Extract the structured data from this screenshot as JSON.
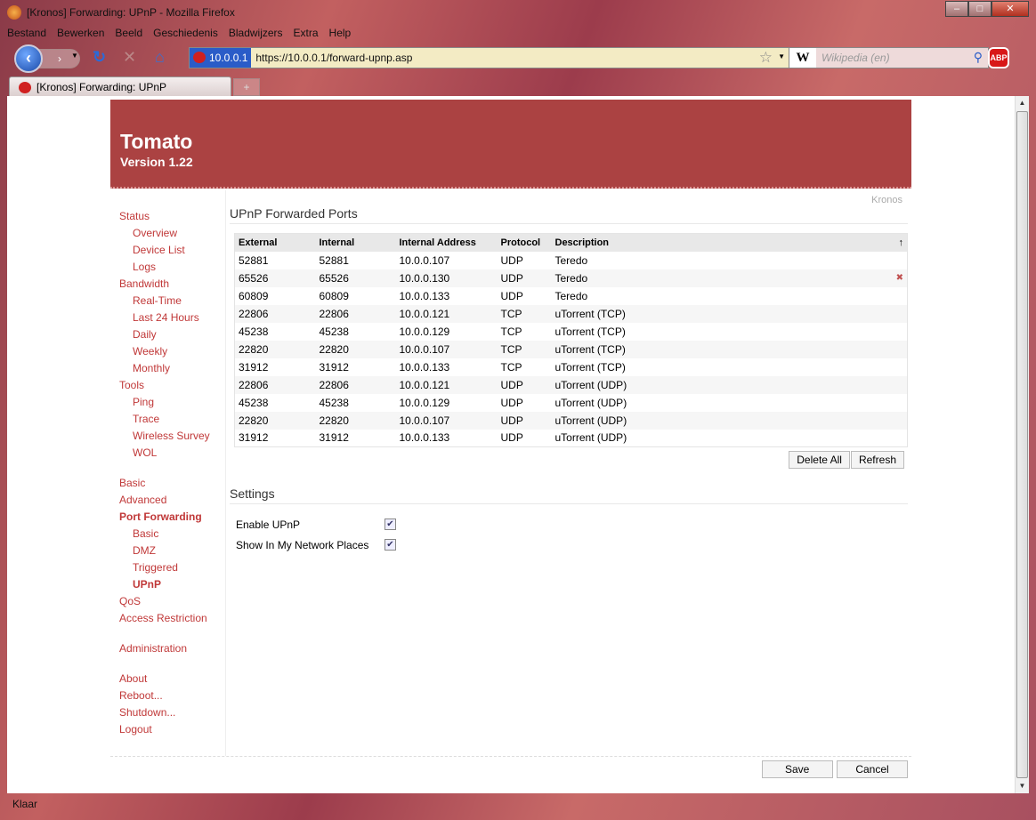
{
  "window": {
    "title": "[Kronos] Forwarding: UPnP - Mozilla Firefox"
  },
  "menu": [
    "Bestand",
    "Bewerken",
    "Beeld",
    "Geschiedenis",
    "Bladwijzers",
    "Extra",
    "Help"
  ],
  "urlbar": {
    "identity": "10.0.0.1",
    "url": "https://10.0.0.1/forward-upnp.asp"
  },
  "search": {
    "engine": "W",
    "placeholder": "Wikipedia (en)"
  },
  "abp": "ABP",
  "tab": {
    "label": "[Kronos] Forwarding: UPnP",
    "new": "+"
  },
  "status": "Klaar",
  "header": {
    "title": "Tomato",
    "version": "Version 1.22"
  },
  "router_name": "Kronos",
  "sidebar": [
    {
      "label": "Status",
      "sub": false
    },
    {
      "label": "Overview",
      "sub": true
    },
    {
      "label": "Device List",
      "sub": true
    },
    {
      "label": "Logs",
      "sub": true
    },
    {
      "label": "Bandwidth",
      "sub": false
    },
    {
      "label": "Real-Time",
      "sub": true
    },
    {
      "label": "Last 24 Hours",
      "sub": true
    },
    {
      "label": "Daily",
      "sub": true
    },
    {
      "label": "Weekly",
      "sub": true
    },
    {
      "label": "Monthly",
      "sub": true
    },
    {
      "label": "Tools",
      "sub": false
    },
    {
      "label": "Ping",
      "sub": true
    },
    {
      "label": "Trace",
      "sub": true
    },
    {
      "label": "Wireless Survey",
      "sub": true
    },
    {
      "label": "WOL",
      "sub": true
    },
    {
      "gap": true
    },
    {
      "label": "Basic",
      "sub": false
    },
    {
      "label": "Advanced",
      "sub": false
    },
    {
      "label": "Port Forwarding",
      "sub": false,
      "active": true
    },
    {
      "label": "Basic",
      "sub": true
    },
    {
      "label": "DMZ",
      "sub": true
    },
    {
      "label": "Triggered",
      "sub": true
    },
    {
      "label": "UPnP",
      "sub": true,
      "active": true
    },
    {
      "label": "QoS",
      "sub": false
    },
    {
      "label": "Access Restriction",
      "sub": false
    },
    {
      "gap": true
    },
    {
      "label": "Administration",
      "sub": false
    },
    {
      "gap": true
    },
    {
      "label": "About",
      "sub": false
    },
    {
      "label": "Reboot...",
      "sub": false
    },
    {
      "label": "Shutdown...",
      "sub": false
    },
    {
      "label": "Logout",
      "sub": false
    }
  ],
  "ports": {
    "title": "UPnP Forwarded Ports",
    "columns": [
      "External",
      "Internal",
      "Internal Address",
      "Protocol",
      "Description"
    ],
    "sort_icon": "↑",
    "rows": [
      [
        "52881",
        "52881",
        "10.0.0.107",
        "UDP",
        "Teredo"
      ],
      [
        "65526",
        "65526",
        "10.0.0.130",
        "UDP",
        "Teredo"
      ],
      [
        "60809",
        "60809",
        "10.0.0.133",
        "UDP",
        "Teredo"
      ],
      [
        "22806",
        "22806",
        "10.0.0.121",
        "TCP",
        "uTorrent (TCP)"
      ],
      [
        "45238",
        "45238",
        "10.0.0.129",
        "TCP",
        "uTorrent (TCP)"
      ],
      [
        "22820",
        "22820",
        "10.0.0.107",
        "TCP",
        "uTorrent (TCP)"
      ],
      [
        "31912",
        "31912",
        "10.0.0.133",
        "TCP",
        "uTorrent (TCP)"
      ],
      [
        "22806",
        "22806",
        "10.0.0.121",
        "UDP",
        "uTorrent (UDP)"
      ],
      [
        "45238",
        "45238",
        "10.0.0.129",
        "UDP",
        "uTorrent (UDP)"
      ],
      [
        "22820",
        "22820",
        "10.0.0.107",
        "UDP",
        "uTorrent (UDP)"
      ],
      [
        "31912",
        "31912",
        "10.0.0.133",
        "UDP",
        "uTorrent (UDP)"
      ]
    ],
    "delete_all": "Delete All",
    "refresh": "Refresh"
  },
  "settings": {
    "title": "Settings",
    "items": [
      {
        "label": "Enable UPnP",
        "checked": true
      },
      {
        "label": "Show In My Network Places",
        "checked": true
      }
    ]
  },
  "footer": {
    "save": "Save",
    "cancel": "Cancel"
  }
}
